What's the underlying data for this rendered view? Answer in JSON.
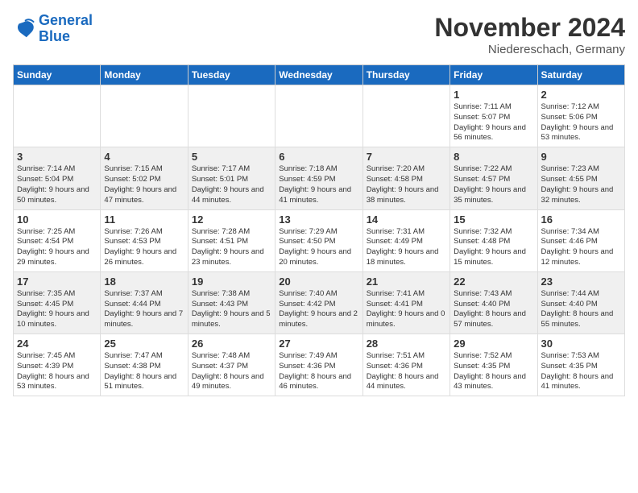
{
  "header": {
    "logo_line1": "General",
    "logo_line2": "Blue",
    "month": "November 2024",
    "location": "Niedereschach, Germany"
  },
  "days_of_week": [
    "Sunday",
    "Monday",
    "Tuesday",
    "Wednesday",
    "Thursday",
    "Friday",
    "Saturday"
  ],
  "weeks": [
    [
      {
        "day": "",
        "info": ""
      },
      {
        "day": "",
        "info": ""
      },
      {
        "day": "",
        "info": ""
      },
      {
        "day": "",
        "info": ""
      },
      {
        "day": "",
        "info": ""
      },
      {
        "day": "1",
        "info": "Sunrise: 7:11 AM\nSunset: 5:07 PM\nDaylight: 9 hours and 56 minutes."
      },
      {
        "day": "2",
        "info": "Sunrise: 7:12 AM\nSunset: 5:06 PM\nDaylight: 9 hours and 53 minutes."
      }
    ],
    [
      {
        "day": "3",
        "info": "Sunrise: 7:14 AM\nSunset: 5:04 PM\nDaylight: 9 hours and 50 minutes."
      },
      {
        "day": "4",
        "info": "Sunrise: 7:15 AM\nSunset: 5:02 PM\nDaylight: 9 hours and 47 minutes."
      },
      {
        "day": "5",
        "info": "Sunrise: 7:17 AM\nSunset: 5:01 PM\nDaylight: 9 hours and 44 minutes."
      },
      {
        "day": "6",
        "info": "Sunrise: 7:18 AM\nSunset: 4:59 PM\nDaylight: 9 hours and 41 minutes."
      },
      {
        "day": "7",
        "info": "Sunrise: 7:20 AM\nSunset: 4:58 PM\nDaylight: 9 hours and 38 minutes."
      },
      {
        "day": "8",
        "info": "Sunrise: 7:22 AM\nSunset: 4:57 PM\nDaylight: 9 hours and 35 minutes."
      },
      {
        "day": "9",
        "info": "Sunrise: 7:23 AM\nSunset: 4:55 PM\nDaylight: 9 hours and 32 minutes."
      }
    ],
    [
      {
        "day": "10",
        "info": "Sunrise: 7:25 AM\nSunset: 4:54 PM\nDaylight: 9 hours and 29 minutes."
      },
      {
        "day": "11",
        "info": "Sunrise: 7:26 AM\nSunset: 4:53 PM\nDaylight: 9 hours and 26 minutes."
      },
      {
        "day": "12",
        "info": "Sunrise: 7:28 AM\nSunset: 4:51 PM\nDaylight: 9 hours and 23 minutes."
      },
      {
        "day": "13",
        "info": "Sunrise: 7:29 AM\nSunset: 4:50 PM\nDaylight: 9 hours and 20 minutes."
      },
      {
        "day": "14",
        "info": "Sunrise: 7:31 AM\nSunset: 4:49 PM\nDaylight: 9 hours and 18 minutes."
      },
      {
        "day": "15",
        "info": "Sunrise: 7:32 AM\nSunset: 4:48 PM\nDaylight: 9 hours and 15 minutes."
      },
      {
        "day": "16",
        "info": "Sunrise: 7:34 AM\nSunset: 4:46 PM\nDaylight: 9 hours and 12 minutes."
      }
    ],
    [
      {
        "day": "17",
        "info": "Sunrise: 7:35 AM\nSunset: 4:45 PM\nDaylight: 9 hours and 10 minutes."
      },
      {
        "day": "18",
        "info": "Sunrise: 7:37 AM\nSunset: 4:44 PM\nDaylight: 9 hours and 7 minutes."
      },
      {
        "day": "19",
        "info": "Sunrise: 7:38 AM\nSunset: 4:43 PM\nDaylight: 9 hours and 5 minutes."
      },
      {
        "day": "20",
        "info": "Sunrise: 7:40 AM\nSunset: 4:42 PM\nDaylight: 9 hours and 2 minutes."
      },
      {
        "day": "21",
        "info": "Sunrise: 7:41 AM\nSunset: 4:41 PM\nDaylight: 9 hours and 0 minutes."
      },
      {
        "day": "22",
        "info": "Sunrise: 7:43 AM\nSunset: 4:40 PM\nDaylight: 8 hours and 57 minutes."
      },
      {
        "day": "23",
        "info": "Sunrise: 7:44 AM\nSunset: 4:40 PM\nDaylight: 8 hours and 55 minutes."
      }
    ],
    [
      {
        "day": "24",
        "info": "Sunrise: 7:45 AM\nSunset: 4:39 PM\nDaylight: 8 hours and 53 minutes."
      },
      {
        "day": "25",
        "info": "Sunrise: 7:47 AM\nSunset: 4:38 PM\nDaylight: 8 hours and 51 minutes."
      },
      {
        "day": "26",
        "info": "Sunrise: 7:48 AM\nSunset: 4:37 PM\nDaylight: 8 hours and 49 minutes."
      },
      {
        "day": "27",
        "info": "Sunrise: 7:49 AM\nSunset: 4:36 PM\nDaylight: 8 hours and 46 minutes."
      },
      {
        "day": "28",
        "info": "Sunrise: 7:51 AM\nSunset: 4:36 PM\nDaylight: 8 hours and 44 minutes."
      },
      {
        "day": "29",
        "info": "Sunrise: 7:52 AM\nSunset: 4:35 PM\nDaylight: 8 hours and 43 minutes."
      },
      {
        "day": "30",
        "info": "Sunrise: 7:53 AM\nSunset: 4:35 PM\nDaylight: 8 hours and 41 minutes."
      }
    ]
  ]
}
